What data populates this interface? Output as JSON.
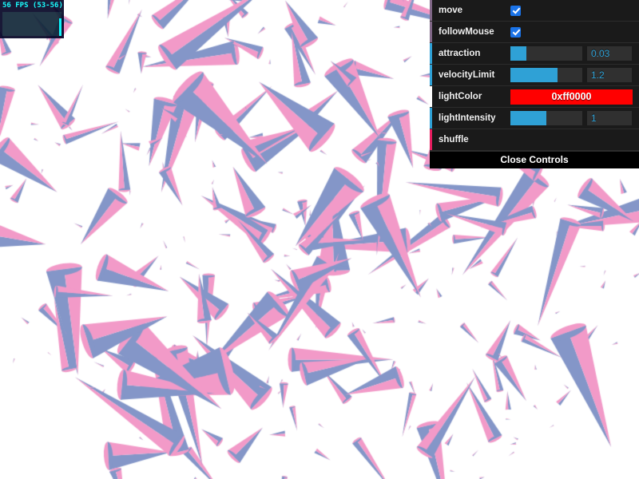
{
  "stats": {
    "readout": "56 FPS (53-56)",
    "fps_current": 56,
    "fps_min": 53,
    "fps_max": 56,
    "graph_bars": [
      0,
      0,
      0,
      0,
      0,
      0,
      0,
      0,
      0,
      0,
      0,
      0,
      0,
      0,
      0,
      0,
      0,
      0,
      0,
      0,
      0,
      0,
      0,
      22
    ],
    "bg_color": "#000022",
    "text_color": "#00ffff"
  },
  "gui": {
    "rows": [
      {
        "name": "move",
        "label": "move",
        "type": "boolean",
        "value": true,
        "marker_color": "#806787"
      },
      {
        "name": "followMouse",
        "label": "followMouse",
        "type": "boolean",
        "value": true,
        "marker_color": "#806787"
      },
      {
        "name": "attraction",
        "label": "attraction",
        "type": "number",
        "value": "0.03",
        "fill_percent": 22,
        "marker_color": "#2fa1d6"
      },
      {
        "name": "velocityLimit",
        "label": "velocityLimit",
        "type": "number",
        "value": "1.2",
        "fill_percent": 66,
        "marker_color": "#2fa1d6"
      },
      {
        "name": "lightColor",
        "label": "lightColor",
        "type": "color",
        "value": "0xff0000",
        "swatch_color": "#ff0000",
        "marker_color": "#ffffff"
      },
      {
        "name": "lightIntensity",
        "label": "lightIntensity",
        "type": "number",
        "value": "1",
        "fill_percent": 50,
        "marker_color": "#2fa1d6"
      },
      {
        "name": "shuffle",
        "label": "shuffle",
        "type": "function",
        "value": "",
        "marker_color": "#e61d5f"
      }
    ],
    "close_label": "Close Controls"
  },
  "scene": {
    "background": "#ffffff",
    "particle_color_a": "#8496c8",
    "particle_color_b": "#f29ac8",
    "particle_count": 330,
    "description": "cone-shaped particles attracted toward centre of canvas"
  }
}
